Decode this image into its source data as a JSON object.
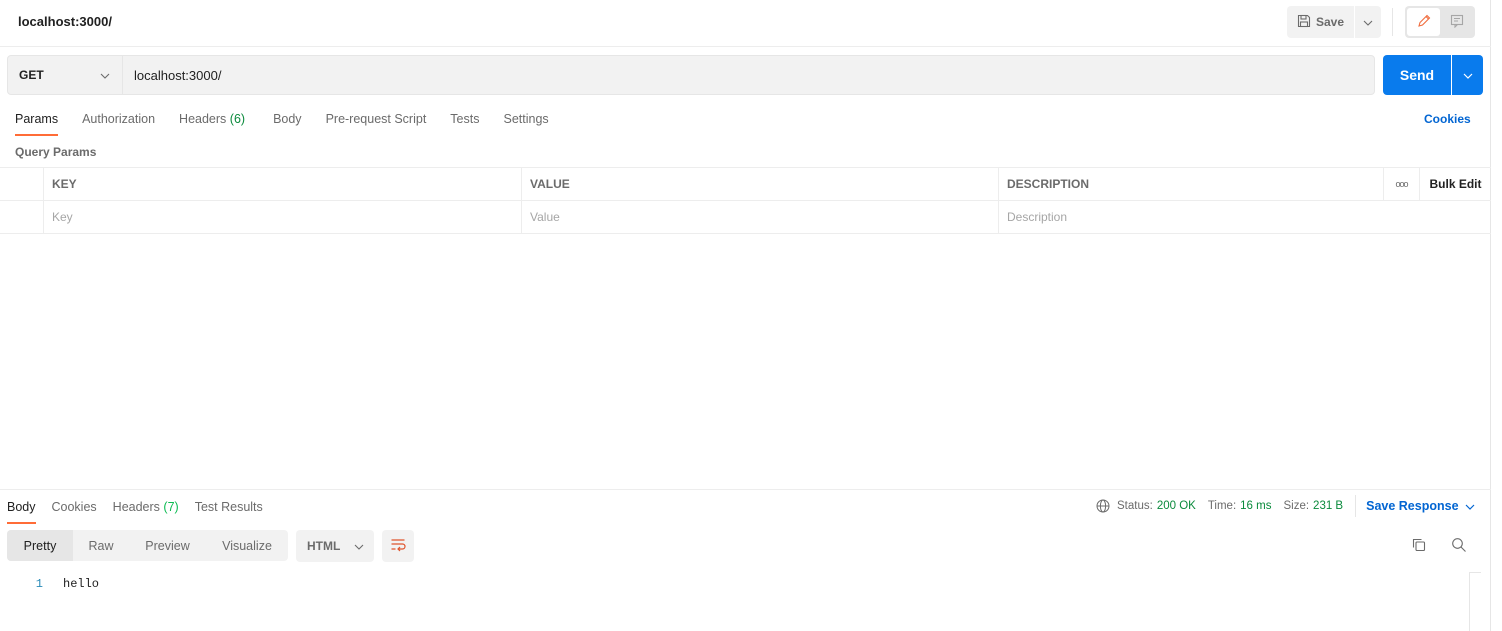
{
  "titlebar": {
    "title": "localhost:3000/",
    "save_label": "Save",
    "icons": {
      "save": "floppy-disk-icon",
      "caret": "chevron-down-icon",
      "edit": "pencil-icon",
      "comments": "comment-icon"
    }
  },
  "request": {
    "method": "GET",
    "url": "localhost:3000/",
    "send_label": "Send"
  },
  "request_tabs": [
    {
      "label": "Params",
      "count": null,
      "active": true
    },
    {
      "label": "Authorization",
      "count": null,
      "active": false
    },
    {
      "label": "Headers",
      "count": "(6)",
      "active": false
    },
    {
      "label": "Body",
      "count": null,
      "active": false
    },
    {
      "label": "Pre-request Script",
      "count": null,
      "active": false
    },
    {
      "label": "Tests",
      "count": null,
      "active": false
    },
    {
      "label": "Settings",
      "count": null,
      "active": false
    }
  ],
  "cookies_label": "Cookies",
  "query_params": {
    "section_label": "Query Params",
    "columns": [
      "KEY",
      "VALUE",
      "DESCRIPTION"
    ],
    "more_icon": "ooo",
    "bulk_edit_label": "Bulk Edit",
    "placeholders": {
      "key": "Key",
      "value": "Value",
      "description": "Description"
    }
  },
  "response_tabs": [
    {
      "label": "Body",
      "count": null,
      "active": true
    },
    {
      "label": "Cookies",
      "count": null,
      "active": false
    },
    {
      "label": "Headers",
      "count": "(7)",
      "active": false
    },
    {
      "label": "Test Results",
      "count": null,
      "active": false
    }
  ],
  "response_status": {
    "status_label": "Status:",
    "status_value": "200 OK",
    "time_label": "Time:",
    "time_value": "16 ms",
    "size_label": "Size:",
    "size_value": "231 B",
    "save_response_label": "Save Response"
  },
  "response_view": {
    "modes": [
      "Pretty",
      "Raw",
      "Preview",
      "Visualize"
    ],
    "active_mode": "Pretty",
    "language": "HTML"
  },
  "response_body": {
    "lines": [
      {
        "number": "1",
        "text": "hello"
      }
    ]
  },
  "colors": {
    "accent": "#ff6c37",
    "primary": "#097bed",
    "link": "#0265d2",
    "success": "#0a8a3c"
  }
}
